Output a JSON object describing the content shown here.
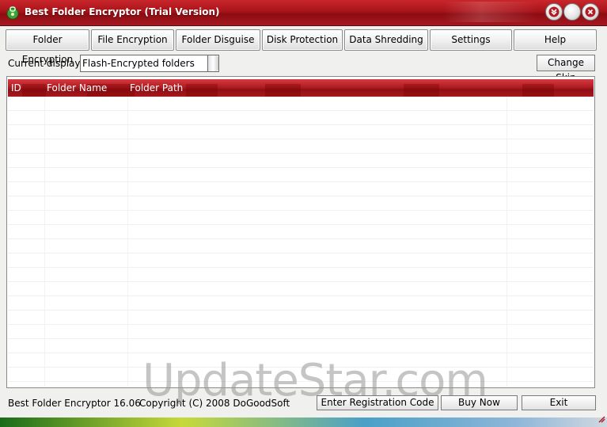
{
  "window": {
    "title": "Best Folder Encryptor (Trial Version)",
    "accent": "#b01d23"
  },
  "titlebar_buttons": [
    {
      "name": "menu-down-icon"
    },
    {
      "name": "maximize-icon"
    },
    {
      "name": "close-icon"
    }
  ],
  "tabs": [
    {
      "label": "Folder Encryption"
    },
    {
      "label": "File Encryption"
    },
    {
      "label": "Folder Disguise"
    },
    {
      "label": "Disk Protection"
    },
    {
      "label": "Data Shredding"
    },
    {
      "label": "Settings"
    },
    {
      "label": "Help"
    }
  ],
  "display": {
    "label": "Current display:",
    "selected": "Flash-Encrypted folders",
    "change_skin": "Change Skin"
  },
  "table": {
    "columns": [
      "ID",
      "Folder Name",
      "Folder Path"
    ],
    "rows": []
  },
  "status": {
    "version": "Best Folder Encryptor 16.06",
    "copyright": "Copyright (C) 2008 DoGoodSoft",
    "register": "Enter Registration Code",
    "buy": "Buy Now",
    "exit": "Exit"
  },
  "watermark": "UpdateStar.com"
}
